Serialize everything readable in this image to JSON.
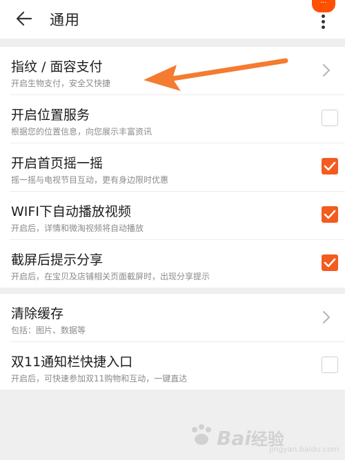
{
  "header": {
    "title": "通用",
    "badge_text": "···"
  },
  "group1": {
    "items": [
      {
        "title": "指纹 / 面容支付",
        "subtitle": "开启生物支付，安全又快捷",
        "control": "chevron"
      },
      {
        "title": "开启位置服务",
        "subtitle": "根据您的位置信息，向您展示丰富资讯",
        "control": "checkbox",
        "checked": false
      },
      {
        "title": "开启首页摇一摇",
        "subtitle": "摇一摇与电视节目互动，更有身边限时优惠",
        "control": "checkbox",
        "checked": true
      },
      {
        "title": "WIFI下自动播放视频",
        "subtitle": "开启后，详情和微淘视频将自动播放",
        "control": "checkbox",
        "checked": true
      },
      {
        "title": "截屏后提示分享",
        "subtitle": "开启后，在宝贝及店铺相关页面截屏时，出现分享提示",
        "control": "checkbox",
        "checked": true
      }
    ]
  },
  "group2": {
    "items": [
      {
        "title": "清除缓存",
        "subtitle": "包括：图片、数据等",
        "control": "chevron"
      },
      {
        "title": "双11通知栏快捷入口",
        "subtitle": "开启后，可快速参加双11购物和互动，一键直达",
        "control": "checkbox",
        "checked": false
      }
    ]
  },
  "watermark": {
    "logo_text": "Bai",
    "suffix_text": "经验",
    "url_text": "jingyan.baidu.com"
  },
  "colors": {
    "accent": "#f35b1f",
    "badge": "#ff5000",
    "annotation_arrow": "#f47b30"
  },
  "icons": {
    "back": "arrow-left-icon",
    "more": "more-vertical-icon",
    "chevron": "chevron-right-icon",
    "check": "checkmark-icon"
  }
}
